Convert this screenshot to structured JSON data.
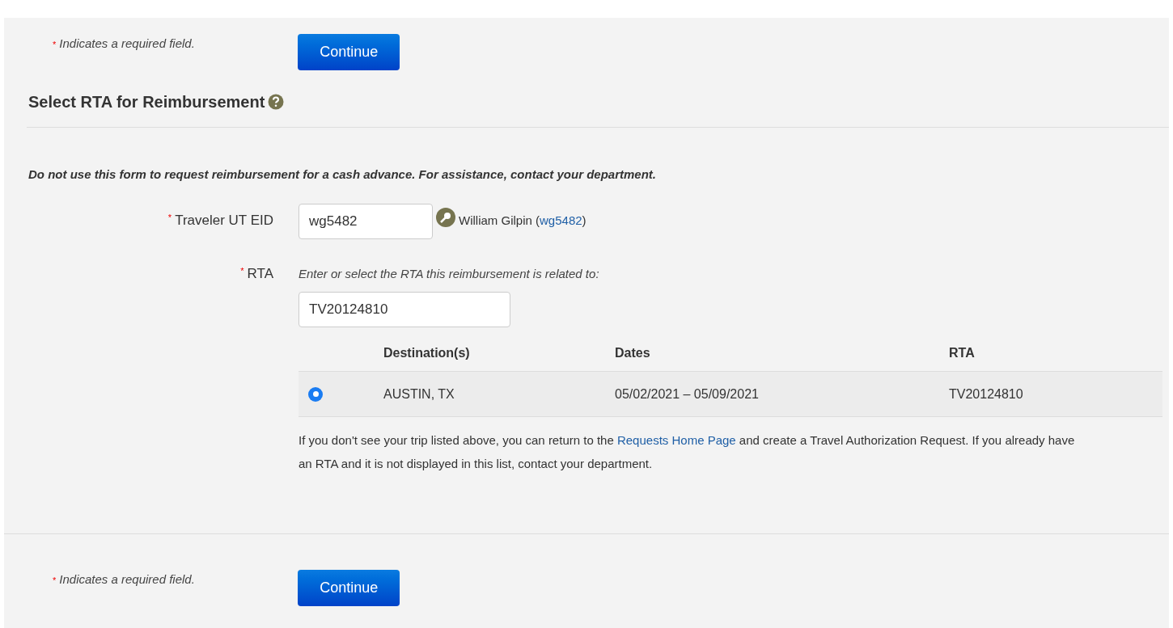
{
  "top_actions": {
    "required_mark": "*",
    "required_note": "Indicates a required field.",
    "button": "Continue"
  },
  "heading": "Select RTA for Reimbursement",
  "notice": "Do not use this form to request reimbursement for a cash advance. For assistance, contact your department.",
  "traveler": {
    "required_mark": "*",
    "label": "Traveler UT EID",
    "value": "wg5482",
    "name_before": "William Gilpin (",
    "link": "wg5482",
    "name_after": ")"
  },
  "rta": {
    "required_mark": "*",
    "label": "RTA",
    "hint": "Enter or select the RTA this reimbursement is related to:",
    "value": "TV20124810"
  },
  "table": {
    "columns": [
      "Destination(s)",
      "Dates",
      "RTA"
    ],
    "rows": [
      {
        "selected": true,
        "cells": [
          "AUSTIN, TX",
          "05/02/2021 – 05/09/2021",
          "TV20124810"
        ]
      }
    ]
  },
  "help": {
    "before": "If you don't see your trip listed above, you can return to the ",
    "link": "Requests Home Page",
    "after": " and create a Travel Authorization Request. If you already have an RTA and it is not displayed in this list, contact your department."
  },
  "bottom_actions": {
    "required_mark": "*",
    "required_note": "Indicates a required field.",
    "button": "Continue"
  }
}
